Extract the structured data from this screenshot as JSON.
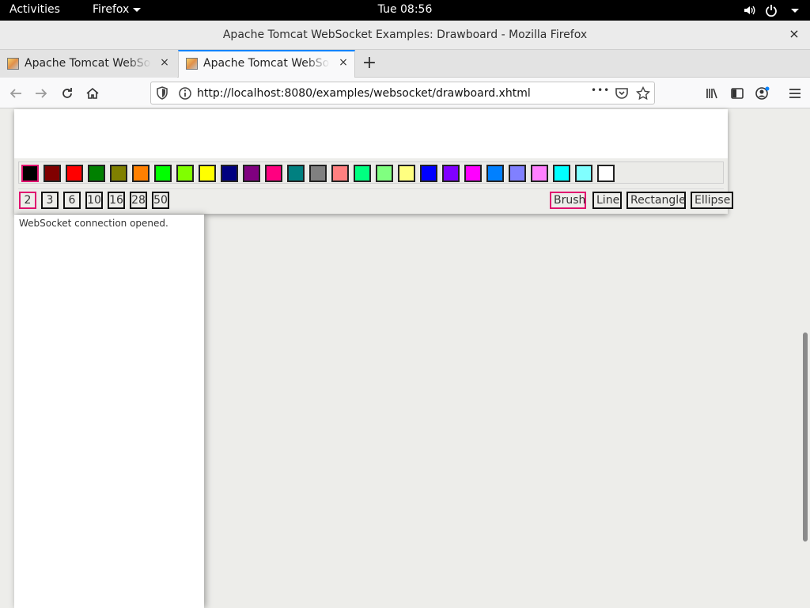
{
  "topbar": {
    "activities": "Activities",
    "app_name": "Firefox",
    "clock": "Tue 08:56"
  },
  "window": {
    "title": "Apache Tomcat WebSocket Examples: Drawboard - Mozilla Firefox",
    "close": "×"
  },
  "tabs": [
    {
      "label": "Apache Tomcat WebSocket Examples: Drawboard"
    },
    {
      "label": "Apache Tomcat WebSocket Examples: Drawboard"
    }
  ],
  "tab_close": "×",
  "new_tab": "+",
  "navbar": {
    "url": "http://localhost:8080/examples/websocket/drawboard.xhtml",
    "more": "•••"
  },
  "palette": {
    "colors": [
      "#000000",
      "#800000",
      "#ff0000",
      "#008000",
      "#808000",
      "#ff8000",
      "#00ff00",
      "#80ff00",
      "#ffff00",
      "#000080",
      "#800080",
      "#ff0080",
      "#008080",
      "#808080",
      "#ff8080",
      "#00ff80",
      "#80ff80",
      "#ffff80",
      "#0000ff",
      "#8000ff",
      "#ff00ff",
      "#0080ff",
      "#8080ff",
      "#ff80ff",
      "#00ffff",
      "#80ffff",
      "#ffffff"
    ],
    "selected_index": 0
  },
  "thickness": {
    "options": [
      "2",
      "3",
      "6",
      "10",
      "16",
      "28",
      "50"
    ],
    "selected_index": 0
  },
  "tools": {
    "options": [
      "Brush",
      "Line",
      "Rectangle",
      "Ellipse"
    ],
    "selected_index": 0
  },
  "accent_color": "#e0126f",
  "console": {
    "message": "WebSocket connection opened."
  }
}
